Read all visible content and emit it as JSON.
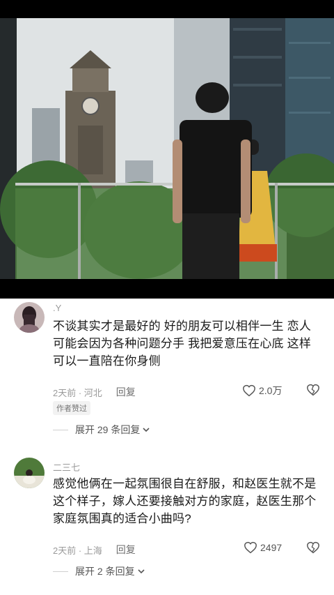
{
  "comments": [
    {
      "username": ".Y",
      "text": "不谈其实才是最好的 好的朋友可以相伴一生 恋人可能会因为各种问题分手 我把爱意压在心底 这样可以一直陪在你身侧",
      "meta": "2天前 · 河北",
      "reply_label": "回复",
      "likes": "2.0万",
      "badge": "作者赞过",
      "expand_label": "展开 29 条回复",
      "avatar_icon": "avatar-girl-long-hair"
    },
    {
      "username": "二三七",
      "text": "感觉他俩在一起氛围很自在舒服，和赵医生就不是这个样子，嫁人还要接触对方的家庭，赵医生那个家庭氛围真的适合小曲吗?",
      "meta": "2天前 · 上海",
      "reply_label": "回复",
      "likes": "2497",
      "expand_label": "展开 2 条回复",
      "avatar_icon": "avatar-person-sitting"
    }
  ],
  "icons": {
    "like": "heart-outline-icon",
    "dislike": "broken-heart-icon",
    "expand": "chevron-down-icon"
  },
  "colors": {
    "text": "#1a1a1a",
    "meta": "#9a9a9a",
    "background": "#ffffff"
  }
}
